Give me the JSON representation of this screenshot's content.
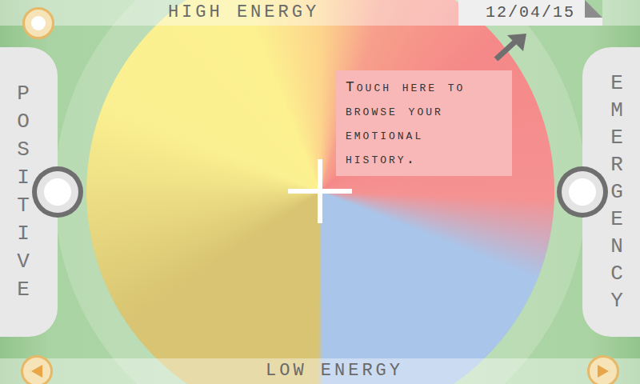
{
  "axes": {
    "top": "HIGH ENERGY",
    "bottom": "LOW ENERGY",
    "left": "POSITIVE",
    "right": "EMERGENCY"
  },
  "date": "12/04/15",
  "tooltip": "Touch here to browse your emotional history."
}
